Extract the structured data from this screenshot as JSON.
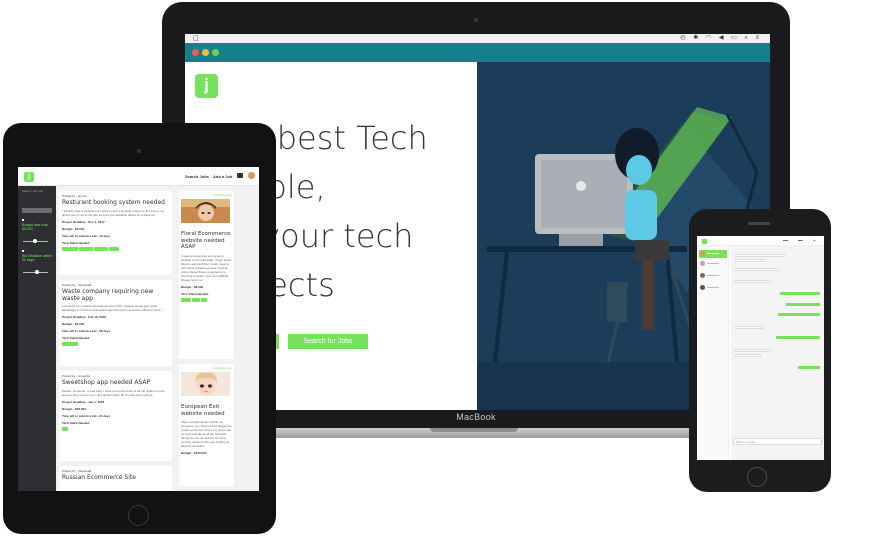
{
  "macbook": {
    "label": "MacBook",
    "hero_title_lines": [
      "The best Tech",
      "people,",
      "for your tech",
      "projects"
    ],
    "hero_search_button": "Search for Jobs",
    "logo_letter": "j"
  },
  "ipad": {
    "header": {
      "logo_letter": "j",
      "search_jobs": "Search Jobs",
      "add_job": "Add a Job"
    },
    "sidebar": {
      "search_label": "Search Job Ads",
      "budget_label": "Budget less than $5,000",
      "deadline_label": "Bid Deadline within 50 days"
    },
    "jobs": [
      {
        "posted": "Posted by - jamesr",
        "title": "Resturant booking system needed",
        "description": "I already have a website but I want to add a booking system to the site so my diners can come to the site and see the available tables for a week pe...",
        "deadline": "Project Deadline - Nov 1, 2017",
        "budget": "Budget - $3,000",
        "time_left": "Time left to submit a bid - 13 days",
        "stack_label": "Tech Stack Needed"
      },
      {
        "posted": "Posted by - thedonald",
        "title": "Waste company requiring new waste app",
        "description": "I currently run a waste disposal service which I believe would gain great advantage to it had an associated app that users can book collection slots f...",
        "deadline": "Project Deadline - Feb 18, 2018",
        "budget": "Budget - $2,500",
        "time_left": "Time left to submit a bid - 58 days",
        "stack_label": "Tech Stack Needed"
      },
      {
        "posted": "Posted by - nimeship",
        "title": "Sweetshop app needed ASAP",
        "description": "Please, someone, I need help. I want to ruin the teeth of all the children in the area so they need to go to the dentist often! My friends owns and ne...",
        "deadline": "Project Deadline - Jan 1, 2018",
        "budget": "Budget - $28,500",
        "time_left": "Time left to submit a bid - 24 days",
        "stack_label": "Tech Stack Needed"
      },
      {
        "posted": "Posted by - thedonald",
        "title": "Russian Ecommerce Site"
      }
    ],
    "ads": [
      {
        "label": "Advertisement",
        "title": "Floral Ecommerce website needed ASAP",
        "description": "I need a responsive ecommerce website to be build asap. I have some flowers and stuff that I really need to sell online because people need an online based flower experience to rival that of apple, uber and airBNB. Please help me!",
        "budget": "Budget - $8,000",
        "stack_label": "Tech Stack Needed"
      },
      {
        "label": "Advertisement",
        "title": "European Exit website needed",
        "description": "After a shock election within my company, my influence has flagged so I want a new site where my peers can go and read about all the fantastic things we can do without our long running neibours who are holding us back for decades",
        "budget": "Budget - $120,000"
      }
    ]
  },
  "iphone": {
    "chat_placeholder": "Write a message..."
  },
  "colors": {
    "accent": "#76e25c",
    "hero_navy": "#1c3d5a",
    "titlebar_teal": "#167f8e"
  }
}
